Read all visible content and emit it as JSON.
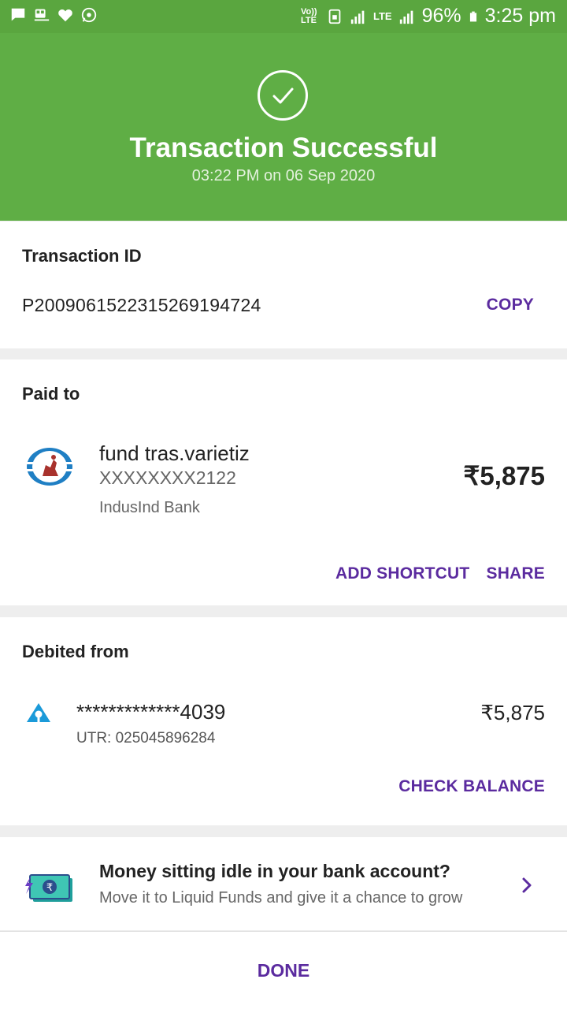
{
  "status_bar": {
    "battery": "96%",
    "time": "3:25 pm",
    "network": "LTE",
    "volte": "Vo)) LTE",
    "icons": [
      "message-icon",
      "train-icon",
      "heart-icon",
      "whatsapp-icon",
      "sim-icon",
      "signal-icon",
      "battery-icon"
    ]
  },
  "header": {
    "title": "Transaction Successful",
    "subtitle": "03:22 PM on 06 Sep 2020",
    "icon": "check-circle-icon",
    "color": "#5fae45"
  },
  "transaction": {
    "label": "Transaction ID",
    "id": "P2009061522315269194724",
    "copy_label": "COPY"
  },
  "paid_to": {
    "label": "Paid to",
    "name": "fund tras.varietiz",
    "account": "XXXXXXXX2122",
    "bank": "IndusInd Bank",
    "amount": "₹5,875",
    "logo": "indusind-bank-logo",
    "actions": {
      "add_shortcut": "ADD SHORTCUT",
      "share": "SHARE"
    }
  },
  "debited_from": {
    "label": "Debited from",
    "account": "*************4039",
    "utr": "UTR: 025045896284",
    "amount": "₹5,875",
    "logo": "sbi-logo",
    "check_balance": "CHECK BALANCE"
  },
  "promo": {
    "title": "Money sitting idle in your bank account?",
    "subtitle": "Move it to Liquid Funds and give it a chance to grow",
    "icon": "rupee-cash-icon"
  },
  "footer": {
    "done_label": "DONE"
  },
  "colors": {
    "accent": "#5b2b9f",
    "success": "#5fae45"
  }
}
